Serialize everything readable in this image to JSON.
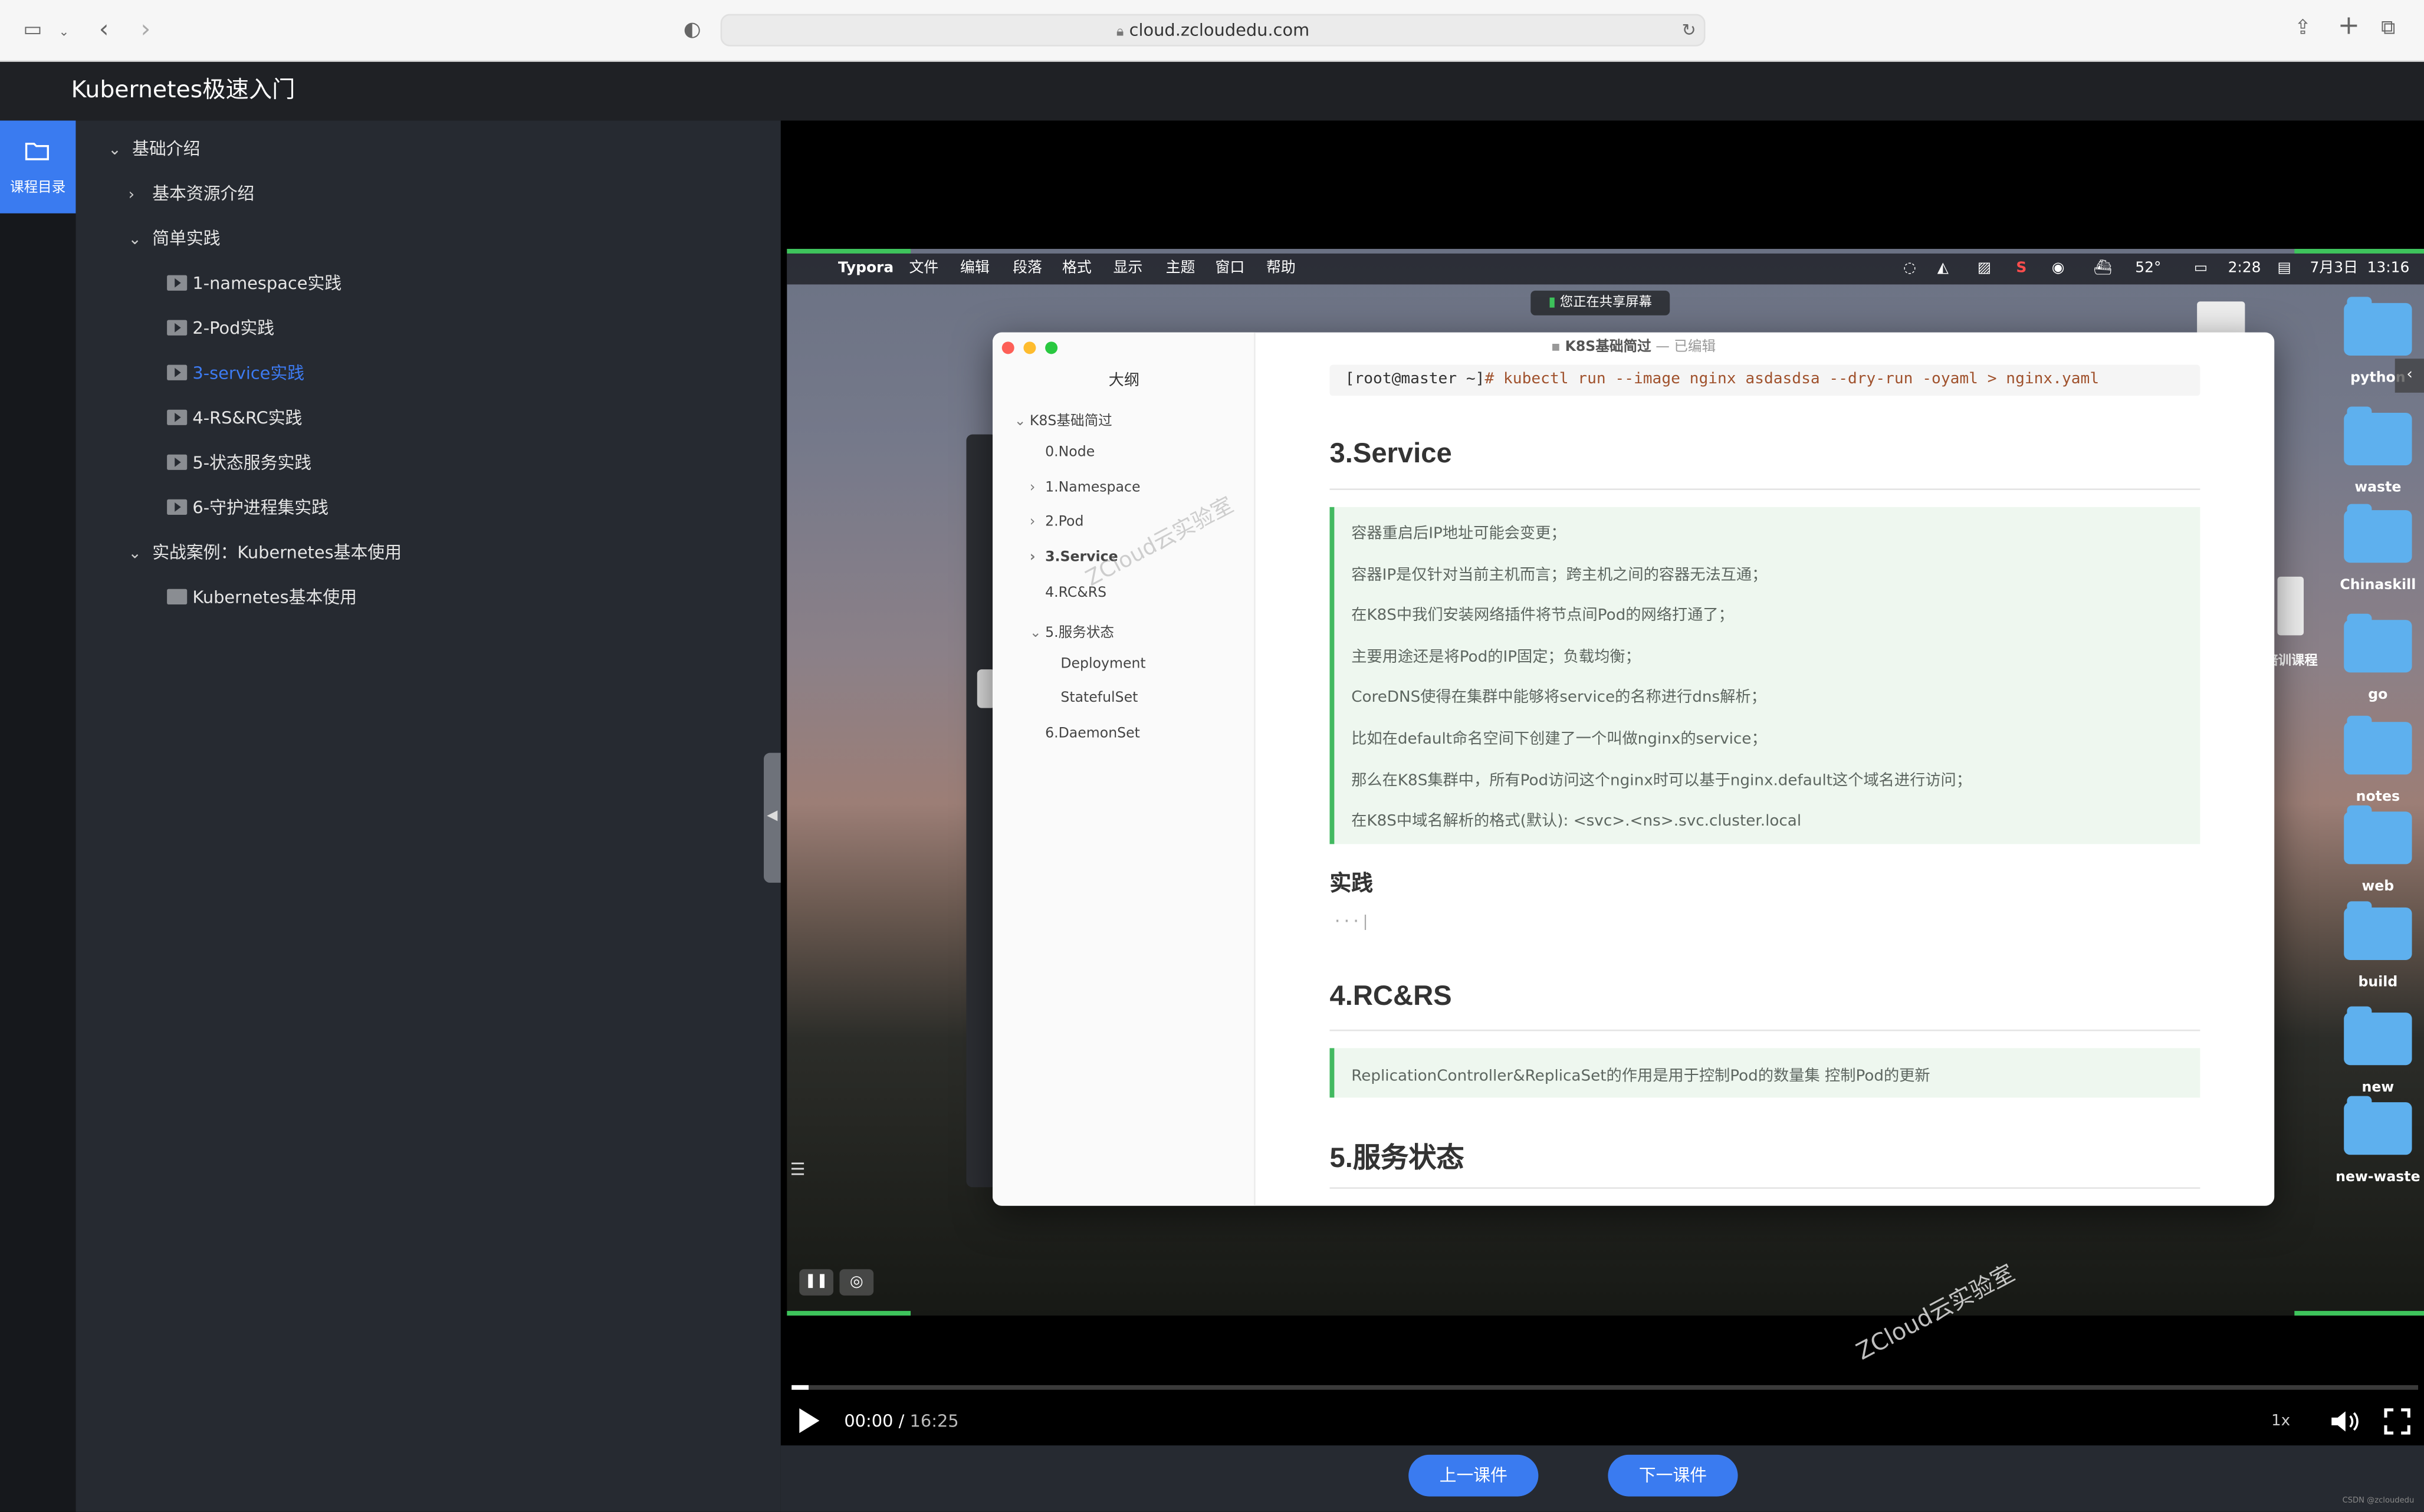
{
  "browser": {
    "url": "cloud.zcloudedu.com"
  },
  "app": {
    "title": "Kubernetes极速入门",
    "rail_label": "课程目录"
  },
  "tree": [
    {
      "label": "基础介绍",
      "level": 0,
      "expanded": true,
      "kind": "section"
    },
    {
      "label": "基本资源介绍",
      "level": 1,
      "expanded": false,
      "kind": "section"
    },
    {
      "label": "简单实践",
      "level": 1,
      "expanded": true,
      "kind": "section"
    },
    {
      "label": "1-namespace实践",
      "level": 2,
      "kind": "video"
    },
    {
      "label": "2-Pod实践",
      "level": 2,
      "kind": "video"
    },
    {
      "label": "3-service实践",
      "level": 2,
      "kind": "video",
      "active": true
    },
    {
      "label": "4-RS&RC实践",
      "level": 2,
      "kind": "video"
    },
    {
      "label": "5-状态服务实践",
      "level": 2,
      "kind": "video"
    },
    {
      "label": "6-守护进程集实践",
      "level": 2,
      "kind": "video"
    },
    {
      "label": "实战案例：Kubernetes基本使用",
      "level": 1,
      "expanded": true,
      "kind": "section"
    },
    {
      "label": "Kubernetes基本使用",
      "level": 2,
      "kind": "lab"
    }
  ],
  "mac_menu": {
    "app": "Typora",
    "items": [
      "文件",
      "编辑",
      "段落",
      "格式",
      "显示",
      "主题",
      "窗口",
      "帮助"
    ],
    "status": {
      "temp": "52°",
      "battery": "2:28",
      "date": "7月3日",
      "time": "13:16"
    },
    "sharing": "您正在共享屏幕"
  },
  "typora": {
    "title": "K8S基础简过",
    "title_status": "— 已编辑",
    "outline_heading": "大纲",
    "outline": [
      {
        "label": "K8S基础简过",
        "level": 0,
        "chev": "⌄"
      },
      {
        "label": "0.Node",
        "level": 1,
        "chev": ""
      },
      {
        "label": "1.Namespace",
        "level": 1,
        "chev": "›"
      },
      {
        "label": "2.Pod",
        "level": 1,
        "chev": "›"
      },
      {
        "label": "3.Service",
        "level": 1,
        "chev": "›",
        "bold": true
      },
      {
        "label": "4.RC&RS",
        "level": 1,
        "chev": ""
      },
      {
        "label": "5.服务状态",
        "level": 1,
        "chev": "⌄"
      },
      {
        "label": "Deployment",
        "level": 2,
        "chev": ""
      },
      {
        "label": "StatefulSet",
        "level": 2,
        "chev": ""
      },
      {
        "label": "6.DaemonSet",
        "level": 1,
        "chev": ""
      }
    ],
    "code_prompt": "[root@master ~]",
    "code_cmd": "# kubectl run --image nginx asdasdsa --dry-run -oyaml > nginx.yaml",
    "h_service": "3.Service",
    "service_quote": [
      "容器重启后IP地址可能会变更；",
      "容器IP是仅针对当前主机而言；跨主机之间的容器无法互通；",
      "在K8S中我们安装网络插件将节点间Pod的网络打通了；",
      "主要用途还是将Pod的IP固定；负载均衡；",
      "CoreDNS使得在集群中能够将service的名称进行dns解析；",
      "比如在default命名空间下创建了一个叫做nginx的service；",
      "那么在K8S集群中，所有Pod访问这个nginx时可以基于nginx.default这个域名进行访问；",
      "在K8S中域名解析的格式(默认): <svc>.<ns>.svc.cluster.local"
    ],
    "h_practice": "实践",
    "code_stub": "···|",
    "h_rcrs": "4.RC&RS",
    "rcrs_quote": "ReplicationController&ReplicaSet的作用是用于控制Pod的数量集 控制Pod的更新",
    "h_state": "5.服务状态"
  },
  "desktop_folders": [
    "python",
    "waste",
    "Chinaskill",
    "go",
    "notes",
    "web",
    "build",
    "new",
    "new-waste"
  ],
  "desktop_file": "培训课程",
  "watermark": "ZCloud云实验室",
  "player": {
    "current": "00:00",
    "separator": "/",
    "duration": "16:25",
    "speed": "1x",
    "progress": 0.01
  },
  "footer": {
    "prev": "上一课件",
    "next": "下一课件",
    "credit": "CSDN @zcloudedu"
  }
}
